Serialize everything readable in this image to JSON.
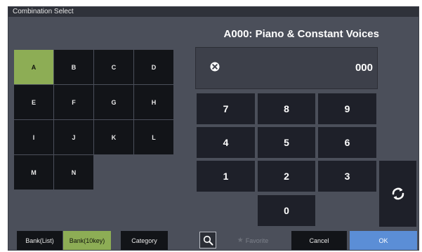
{
  "window": {
    "title": "Combination Select"
  },
  "combination": {
    "title": "A000: Piano & Constant Voices",
    "number": "000"
  },
  "banks": {
    "selected": "A",
    "items": [
      "A",
      "B",
      "C",
      "D",
      "E",
      "F",
      "G",
      "H",
      "I",
      "J",
      "K",
      "L",
      "M",
      "N"
    ]
  },
  "keypad": {
    "keys": [
      "7",
      "8",
      "9",
      "4",
      "5",
      "6",
      "1",
      "2",
      "3",
      "0"
    ],
    "refresh_icon": "refresh-icon",
    "clear_icon": "clear-icon"
  },
  "bottom_bar": {
    "bank_list": "Bank(List)",
    "bank_10key": "Bank(10key)",
    "category": "Category",
    "search_icon": "search-icon",
    "favorite": "Favorite",
    "cancel": "Cancel",
    "ok": "OK"
  },
  "colors": {
    "selected_green": "#8dad55",
    "ok_blue": "#5b8ed6"
  }
}
